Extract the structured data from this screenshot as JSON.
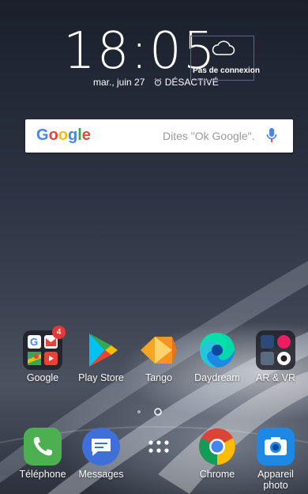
{
  "clock": {
    "time": "18:05",
    "date": "mar., juin 27",
    "alarm": "DÉSACTIVÉ"
  },
  "weather": {
    "status": "Pas de connexion",
    "icon": "cloud-icon"
  },
  "search": {
    "logo": "Google",
    "hint": "Dites \"Ok Google\".",
    "colors": {
      "blue": "#4285F4",
      "red": "#EA4335",
      "yellow": "#FBBC05",
      "green": "#34A853"
    }
  },
  "apps": {
    "row": [
      {
        "label": "Google",
        "badge": "4"
      },
      {
        "label": "Play Store"
      },
      {
        "label": "Tango"
      },
      {
        "label": "Daydream"
      },
      {
        "label": "AR & VR"
      }
    ],
    "dock": [
      {
        "label": "Téléphone"
      },
      {
        "label": "Messages"
      },
      {
        "label": ""
      },
      {
        "label": "Chrome"
      },
      {
        "label": "Appareil photo"
      }
    ]
  }
}
